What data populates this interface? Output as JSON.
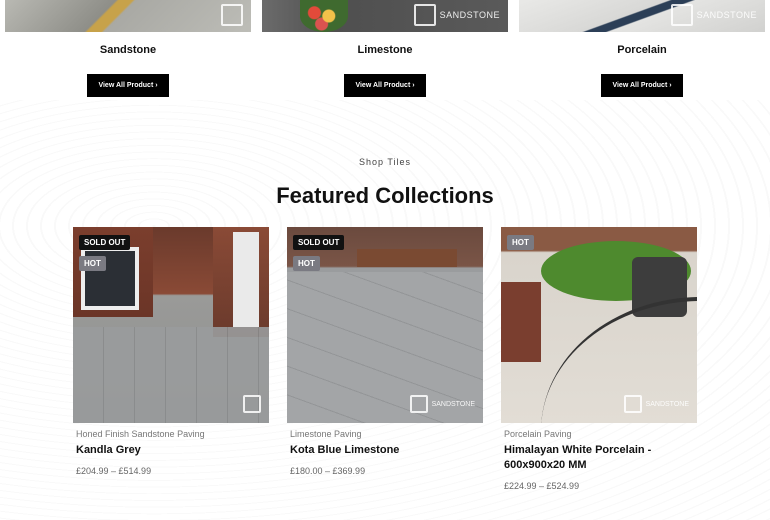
{
  "categories": [
    {
      "name": "Sandstone",
      "button": "View All Product ›"
    },
    {
      "name": "Limestone",
      "button": "View All Product ›"
    },
    {
      "name": "Porcelain",
      "button": "View All Product ›"
    }
  ],
  "watermark": "SANDSTONE",
  "section": {
    "eyebrow": "Shop Tiles",
    "heading": "Featured Collections"
  },
  "products": [
    {
      "sold_out": "SOLD OUT",
      "hot": "HOT",
      "category": "Honed Finish Sandstone Paving",
      "title": "Kandla Grey",
      "price": "£204.99 – £514.99"
    },
    {
      "sold_out": "SOLD OUT",
      "hot": "HOT",
      "category": "Limestone Paving",
      "title": "Kota Blue Limestone",
      "price": "£180.00 – £369.99"
    },
    {
      "hot": "HOT",
      "category": "Porcelain Paving",
      "title": "Himalayan White Porcelain - 600x900x20 MM",
      "price": "£224.99 – £524.99"
    }
  ]
}
